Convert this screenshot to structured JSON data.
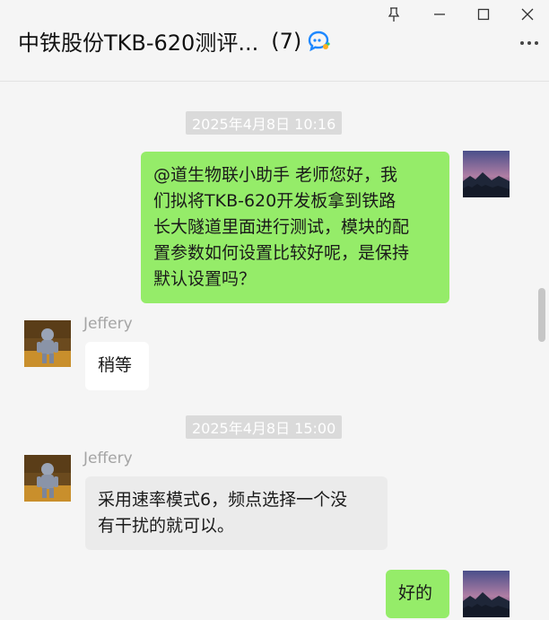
{
  "window": {
    "controls": [
      "pin-icon",
      "minimize-icon",
      "maximize-icon",
      "close-icon"
    ]
  },
  "header": {
    "title": "中铁股份TKB-620测评...",
    "member_count": "(7)"
  },
  "messages": {
    "time1": "2025年4月8日 10:16",
    "msg1_lines": [
      "@道生物联小助手 老师您好，我",
      "们拟将TKB-620开发板拿到铁路",
      "长大隧道里面进行测试，模块的配",
      "置参数如何设置比较好呢，是保持",
      "默认设置吗？"
    ],
    "sender1": "Jeffery",
    "msg2": "稍等",
    "time2": "2025年4月8日 15:00",
    "sender2": "Jeffery",
    "msg3_lines": [
      "采用速率模式6，频点选择一个没",
      "有干扰的就可以。"
    ],
    "msg4": "好的"
  },
  "colors": {
    "my_bubble": "#95ec69",
    "other_bubble": "#ffffff",
    "background": "#f5f5f5"
  }
}
